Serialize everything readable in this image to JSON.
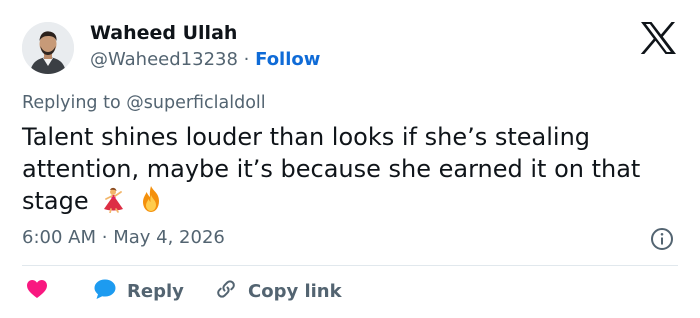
{
  "author": {
    "name": "Waheed Ullah",
    "handle": "@Waheed13238",
    "separator": "·",
    "follow_label": "Follow"
  },
  "reply_to": {
    "prefix": "Replying to",
    "mention": "@superficlaldoll"
  },
  "tweet": {
    "text": "Talent shines louder than looks if she’s stealing attention, maybe it’s because she earned it on that stage",
    "emojis": [
      "dancer-emoji",
      "fire-emoji"
    ]
  },
  "meta": {
    "time": "6:00 AM",
    "separator": "·",
    "date": "May 4, 2026"
  },
  "actions": {
    "reply_label": "Reply",
    "copy_label": "Copy link"
  },
  "colors": {
    "like": "#f91880",
    "reply": "#1d9bf0",
    "follow": "#0f6bd7",
    "muted": "#536471",
    "text": "#0f1419"
  }
}
